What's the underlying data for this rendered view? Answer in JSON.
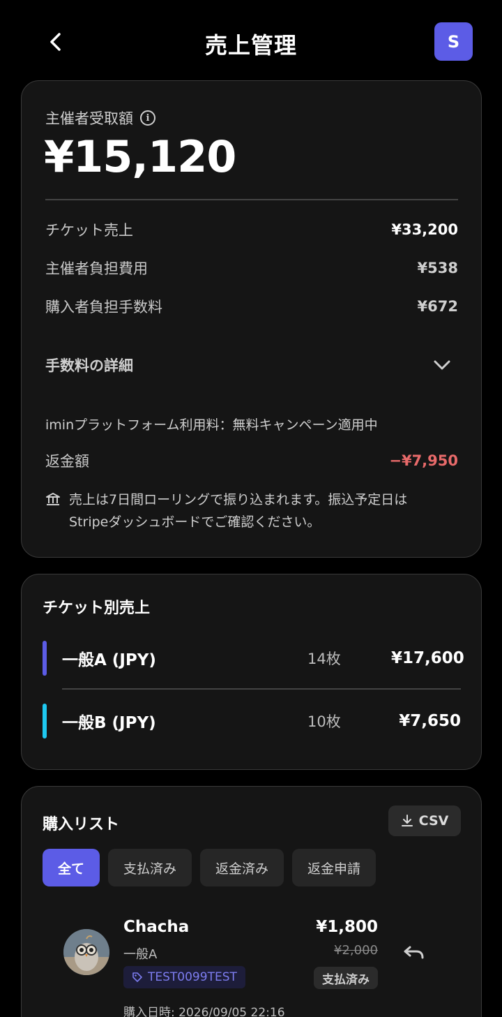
{
  "header": {
    "title": "売上管理",
    "avatar_initial": "S"
  },
  "summary": {
    "receive_label": "主催者受取額",
    "receive_amount": "¥15,120",
    "rows": [
      {
        "label": "チケット売上",
        "value": "¥33,200"
      },
      {
        "label": "主催者負担費用",
        "value": "¥538"
      },
      {
        "label": "購入者負担手数料",
        "value": "¥672"
      }
    ],
    "fee_detail_label": "手数料の詳細",
    "campaign_text": "iminプラットフォーム利用料：無料キャンペーン適用中",
    "refund_label": "返金額",
    "refund_value": "−¥7,950",
    "note_line1": "売上は7日間ローリングで振り込まれます。振込予定日は",
    "note_line2": "Stripeダッシュボードでご確認ください。"
  },
  "ticket_sales": {
    "title": "チケット別売上",
    "items": [
      {
        "name": "一般A (JPY)",
        "qty": "14枚",
        "amount": "¥17,600",
        "color": "#5c5ce6"
      },
      {
        "name": "一般B (JPY)",
        "qty": "10枚",
        "amount": "¥7,650",
        "color": "#1ec8f0"
      }
    ]
  },
  "purchase_list": {
    "title": "購入リスト",
    "csv_label": "CSV",
    "tabs": [
      "全て",
      "支払済み",
      "返金済み",
      "返金申請"
    ],
    "active_tab": 0,
    "entries": [
      {
        "name": "Chacha",
        "ticket": "一般A",
        "coupon": "TEST0099TEST",
        "date": "購入日時: 2026/09/05 22:16",
        "price": "¥1,800",
        "original_price": "¥2,000",
        "status": "支払済み"
      }
    ]
  },
  "colors": {
    "accent": "#5c5ce6",
    "refund_red": "#e86a6a",
    "cyan": "#1ec8f0"
  }
}
